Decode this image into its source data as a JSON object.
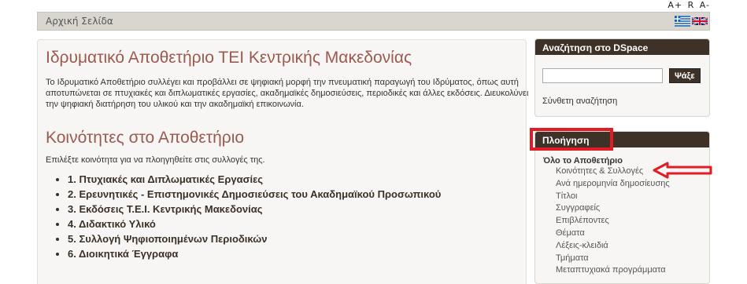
{
  "font_size_controls": {
    "larger": "A+",
    "reset": "R",
    "smaller": "A-"
  },
  "breadcrumb": {
    "home": "Αρχική Σελίδα"
  },
  "languages": [
    "greek-flag-icon",
    "uk-flag-icon"
  ],
  "main": {
    "title": "Ιδρυματικό Αποθετήριο ΤΕΙ Κεντρικής Μακεδονίας",
    "intro": "Το Ιδρυματικό Αποθετήριο συλλέγει και προβάλλει σε ψηφιακή μορφή την πνευματική παραγωγή του Ιδρύματος, όπως αυτή αποτυπώνεται σε πτυχιακές και διπλωματικές εργασίες, ακαδημαϊκές δημοσιεύσεις, περιοδικές και άλλες εκδόσεις. Διευκολύνει την ψηφιακή διατήρηση του υλικού και την ακαδημαϊκή επικοινωνία.",
    "communities_title": "Κοινότητες στο Αποθετήριο",
    "select_text": "Επιλέξτε κοινότητα για να πλοηγηθείτε στις συλλογές της.",
    "communities": [
      "1. Πτυχιακές και Διπλωματικές Εργασίες",
      "2. Ερευνητικές - Επιστημονικές Δημοσιεύσεις του Ακαδημαϊκού Προσωπικού",
      "3. Εκδόσεις Τ.Ε.Ι. Κεντρικής Μακεδονίας",
      "4. Διδακτικό Υλικό",
      "5. Συλλογή Ψηφιοποιημένων Περιοδικών",
      "6. Διοικητικά Έγγραφα"
    ]
  },
  "search": {
    "title": "Αναζήτηση στο DSpace",
    "input_value": "",
    "button": "Ψάξε",
    "advanced": "Σύνθετη αναζήτηση"
  },
  "navigation": {
    "title": "Πλοήγηση",
    "group": "Όλο το Αποθετήριο",
    "items": [
      "Κοινότητες & Συλλογές",
      "Ανά ημερομηνία δημοσίευσης",
      "Τίτλοι",
      "Συγγραφείς",
      "Επιβλέποντες",
      "Θέματα",
      "Λέξεις-κλειδιά",
      "Τμήματα",
      "Μεταπτυχιακά προγράμματα"
    ]
  },
  "colors": {
    "header_bar": "#3d3128",
    "title": "#9b5a4f",
    "highlight": "#e11c24"
  }
}
